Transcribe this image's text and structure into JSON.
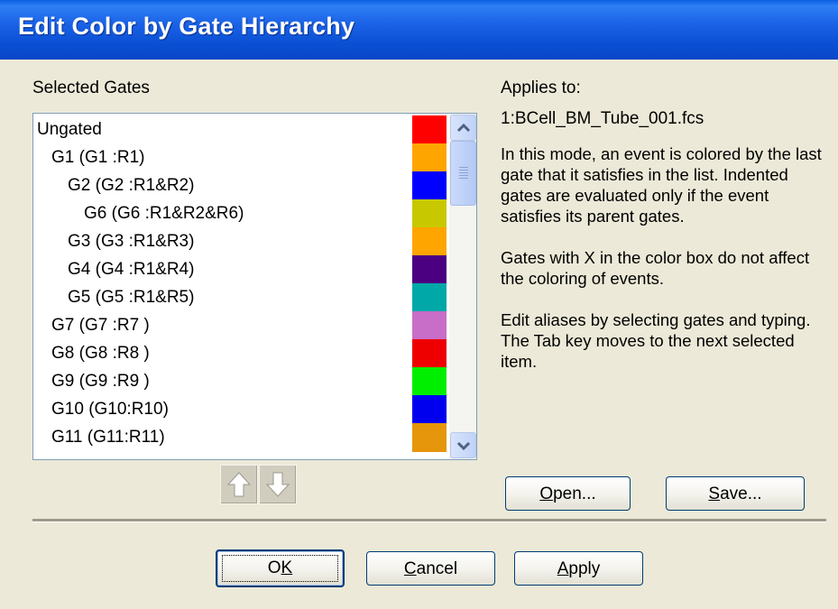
{
  "window": {
    "title": "Edit Color by Gate Hierarchy"
  },
  "selected_gates": {
    "label": "Selected Gates",
    "rows": [
      {
        "text": "Ungated",
        "indent": 0,
        "color": "#ff0000"
      },
      {
        "text": "G1  (G1 :R1)",
        "indent": 1,
        "color": "#ffa500"
      },
      {
        "text": "G2  (G2 :R1&R2)",
        "indent": 2,
        "color": "#0000ff"
      },
      {
        "text": "G6  (G6 :R1&R2&R6)",
        "indent": 3,
        "color": "#c8c800"
      },
      {
        "text": "G3  (G3 :R1&R3)",
        "indent": 2,
        "color": "#ffa500"
      },
      {
        "text": "G4  (G4 :R1&R4)",
        "indent": 2,
        "color": "#4b0082"
      },
      {
        "text": "G5  (G5 :R1&R5)",
        "indent": 2,
        "color": "#00a8a8"
      },
      {
        "text": "G7  (G7 :R7 )",
        "indent": 1,
        "color": "#c86ec8"
      },
      {
        "text": "G8  (G8 :R8 )",
        "indent": 1,
        "color": "#ee0000"
      },
      {
        "text": "G9  (G9 :R9 )",
        "indent": 1,
        "color": "#00ee00"
      },
      {
        "text": "G10 (G10:R10)",
        "indent": 1,
        "color": "#0000ee"
      },
      {
        "text": "G11 (G11:R11)",
        "indent": 1,
        "color": "#e6960a"
      }
    ]
  },
  "applies_to": {
    "label": "Applies to:",
    "file": "1:BCell_BM_Tube_001.fcs"
  },
  "description": [
    "In this mode, an event is colored by the last gate that it satisfies in the list. Indented gates are evaluated only if the event satisfies its parent gates.",
    "Gates with X in the color box do not affect the coloring of events.",
    "Edit aliases by selecting gates and typing.  The Tab key moves to the next selected item."
  ],
  "buttons": {
    "open": {
      "mnemonic": "O",
      "rest": "pen..."
    },
    "save": {
      "mnemonic": "S",
      "rest": "ave..."
    },
    "ok": {
      "pre": "O",
      "mnemonic": "K"
    },
    "cancel": {
      "mnemonic": "C",
      "rest": "ancel"
    },
    "apply": {
      "mnemonic": "A",
      "rest": "pply"
    }
  },
  "icons": {
    "move_up": "arrow-up-icon",
    "move_down": "arrow-down-icon",
    "scroll_up": "chevron-up-icon",
    "scroll_down": "chevron-down-icon"
  }
}
